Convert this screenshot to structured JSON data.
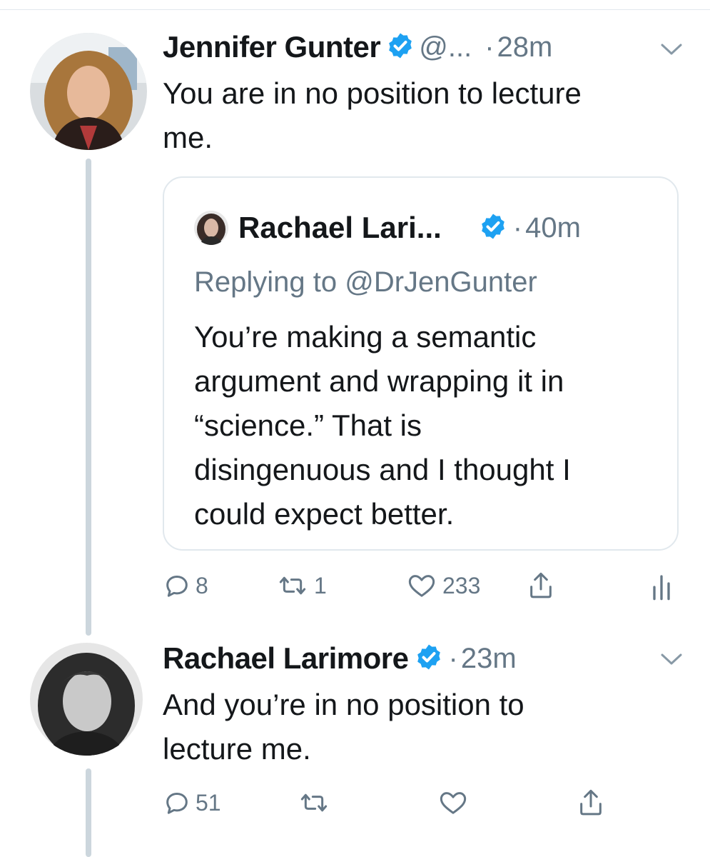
{
  "tweet_main": {
    "display_name": "Jennifer Gunter",
    "handle": "@...",
    "dot": "·",
    "time": "28m",
    "text_line1": "You are in no position to lecture",
    "text_line2": "me.",
    "quoted": {
      "display_name": "Rachael Lari...",
      "dot": "·",
      "time": "40m",
      "replying_to": "Replying to @DrJenGunter",
      "lines": [
        "You’re making a semantic",
        "argument and wrapping it in",
        "“science.” That is",
        "disingenuous and I thought I",
        "could expect better."
      ]
    },
    "actions": {
      "replies": "8",
      "retweets": "1",
      "likes": "233"
    }
  },
  "tweet_reply": {
    "display_name": "Rachael Larimore",
    "dot": "·",
    "time": "23m",
    "text_line1": "And you’re in no position to",
    "text_line2": "lecture me.",
    "actions": {
      "replies": "51"
    }
  },
  "colors": {
    "text": "#14171a",
    "secondary": "#657786",
    "verified_blue": "#1da1f2",
    "border": "#e1e8ed",
    "thread_line": "#ccd6dd"
  },
  "icons": [
    "verified-badge-icon",
    "chevron-down-icon",
    "reply-icon",
    "retweet-icon",
    "like-icon",
    "share-icon",
    "analytics-icon"
  ]
}
